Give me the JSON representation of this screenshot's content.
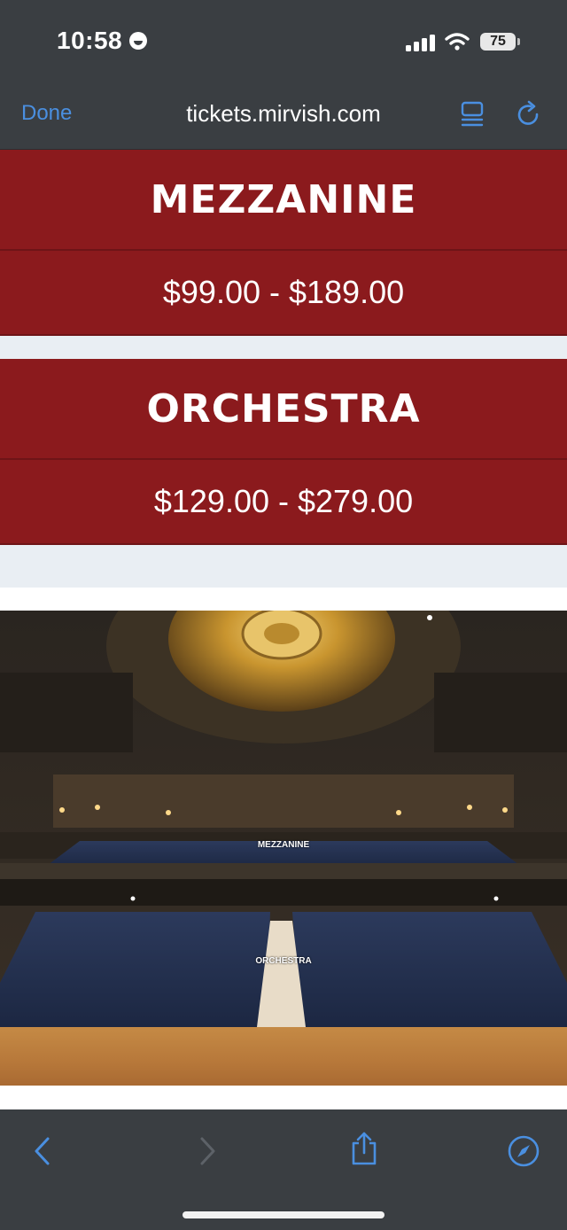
{
  "status": {
    "time": "10:58",
    "battery": "75"
  },
  "browser": {
    "done_label": "Done",
    "url": "tickets.mirvish.com"
  },
  "tiers": [
    {
      "name": "MEZZANINE",
      "price": "$99.00 - $189.00"
    },
    {
      "name": "ORCHESTRA",
      "price": "$129.00 - $279.00"
    }
  ],
  "seating_image": {
    "labels": {
      "mezzanine": "MEZZANINE",
      "orchestra": "ORCHESTRA"
    }
  },
  "colors": {
    "tier_background": "#8b1a1d",
    "chrome": "#3a3e42",
    "accent": "#4a8fe0"
  },
  "toolbar": {
    "icons": [
      "back-icon",
      "forward-icon",
      "share-icon",
      "compass-icon"
    ]
  }
}
